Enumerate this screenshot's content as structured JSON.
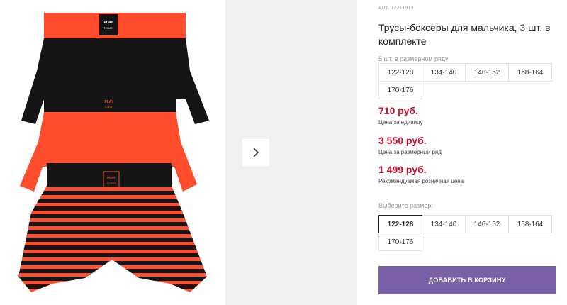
{
  "gallery": {
    "image_alt": "Product photo: three boxer briefs — black, orange, striped",
    "brand_print": "PLAY TODAY",
    "next_icon": "chevron-right-icon",
    "colors": {
      "orange": "#ff4d2e",
      "black": "#151515",
      "side_bg": "#f0f0f0"
    }
  },
  "product": {
    "article": "АРТ. 12211913",
    "title": "Трусы-боксеры для мальчика, 3 шт. в комплекте"
  },
  "size_row": {
    "label": "5 шт. в размерном ряду",
    "sizes": [
      "122-128",
      "134-140",
      "146-152",
      "158-164",
      "170-176"
    ]
  },
  "prices": {
    "unit_price": "710 руб.",
    "unit_note": "Цена за единицу",
    "row_price": "3 550 руб.",
    "row_note": "Цена за размерный ряд",
    "retail_price": "1 499 руб.",
    "retail_note": "Рекомендуемая розничная цена"
  },
  "size_select": {
    "label": "Выберите размер:",
    "sizes": [
      "122-128",
      "134-140",
      "146-152",
      "158-164",
      "170-176"
    ],
    "selected": "122-128"
  },
  "cart": {
    "button_label": "ДОБАВИТЬ В КОРЗИНУ",
    "accent": "#7b62a8"
  }
}
